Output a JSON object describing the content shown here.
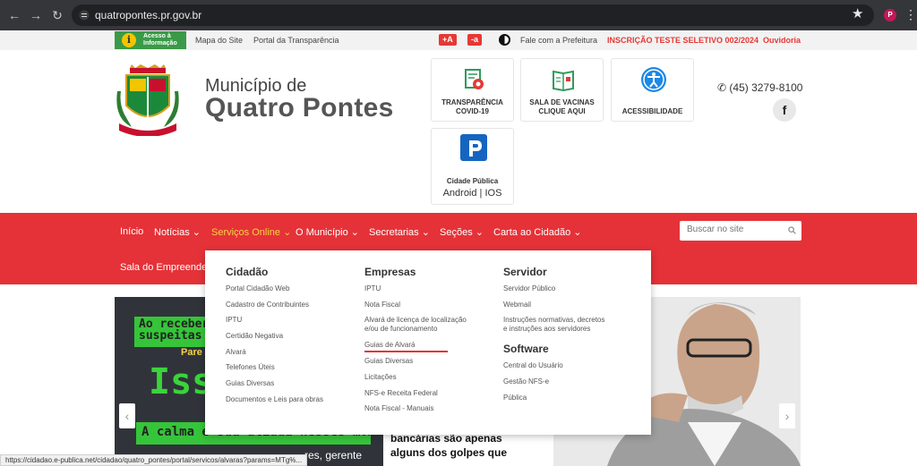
{
  "browser": {
    "url": "quatropontes.pr.gov.br",
    "profile_initial": "P"
  },
  "topbar": {
    "acesso_line1": "Acesso à",
    "acesso_line2": "Informação",
    "mapa": "Mapa do Site",
    "portal": "Portal da Transparência",
    "font_plus": "+A",
    "font_minus": "-a",
    "fale": "Fale com a Prefeitura",
    "inscricao": "INSCRIÇÃO TESTE SELETIVO 002/2024",
    "ouvidoria": "Ouvidoria"
  },
  "header": {
    "municipio": "Município de",
    "nome": "Quatro Pontes",
    "phone": "(45) 3279-8100",
    "facebook": "f"
  },
  "cards": {
    "transparencia_1": "TRANSPARÊNCIA",
    "transparencia_2": "COVID-19",
    "vacinas_1": "SALA DE VACINAS",
    "vacinas_2": "CLIQUE AQUI",
    "acessibilidade": "ACESSIBILIDADE",
    "cidade_1": "Cidade Pública",
    "cidade_2": "Android | IOS"
  },
  "nav": {
    "inicio": "Início",
    "noticias": "Notícias ⌄",
    "servicos": "Serviços Online ⌄",
    "municipio": "O Município ⌄",
    "secretarias": "Secretarias ⌄",
    "secoes": "Seções ⌄",
    "carta": "Carta ao Cidadão ⌄",
    "sala": "Sala do Empreended",
    "search_placeholder": "Buscar no site"
  },
  "mega": {
    "cidadao": {
      "title": "Cidadão",
      "items": [
        "Portal Cidadão Web",
        "Cadastro de Contribuintes",
        "IPTU",
        "Certidão Negativa",
        "Alvará",
        "Telefones Úteis",
        "Guias Diversas",
        "Documentos e Leis para obras"
      ]
    },
    "empresas": {
      "title": "Empresas",
      "items": [
        "IPTU",
        "Nota Fiscal",
        "Alvará de licença de localização",
        "e/ou de funcionamento",
        "Guias de Alvará",
        "Guias Diversas",
        "Licitações",
        "NFS-e Receita Federal",
        "Nota Fiscal - Manuais"
      ]
    },
    "servidor": {
      "title": "Servidor",
      "items": [
        "Servidor Público",
        "Webmail",
        "Instruções normativas, decretos",
        "e instruções aos servidores"
      ]
    },
    "software": {
      "title": "Software",
      "items": [
        "Central do Usuário",
        "Gestão NFS-e",
        "Pública"
      ]
    }
  },
  "banner": {
    "green_line1": "Ao receber lig",
    "green_line2": "suspeitas en",
    "pare": "Pare",
    "isso": "Isso",
    "acalma": "A calma é sua aliada nesses momentos.",
    "gerente1": "res, gerente",
    "bancarias1": "bancárias   são   apenas",
    "bancarias2": "alguns dos golpes que",
    "arrow_left": "‹",
    "arrow_right": "›"
  },
  "status_url": "https://cidadao.e-publica.net/cidadao/quatro_pontes/portal/servicos/alvaras?params=MTg%..."
}
